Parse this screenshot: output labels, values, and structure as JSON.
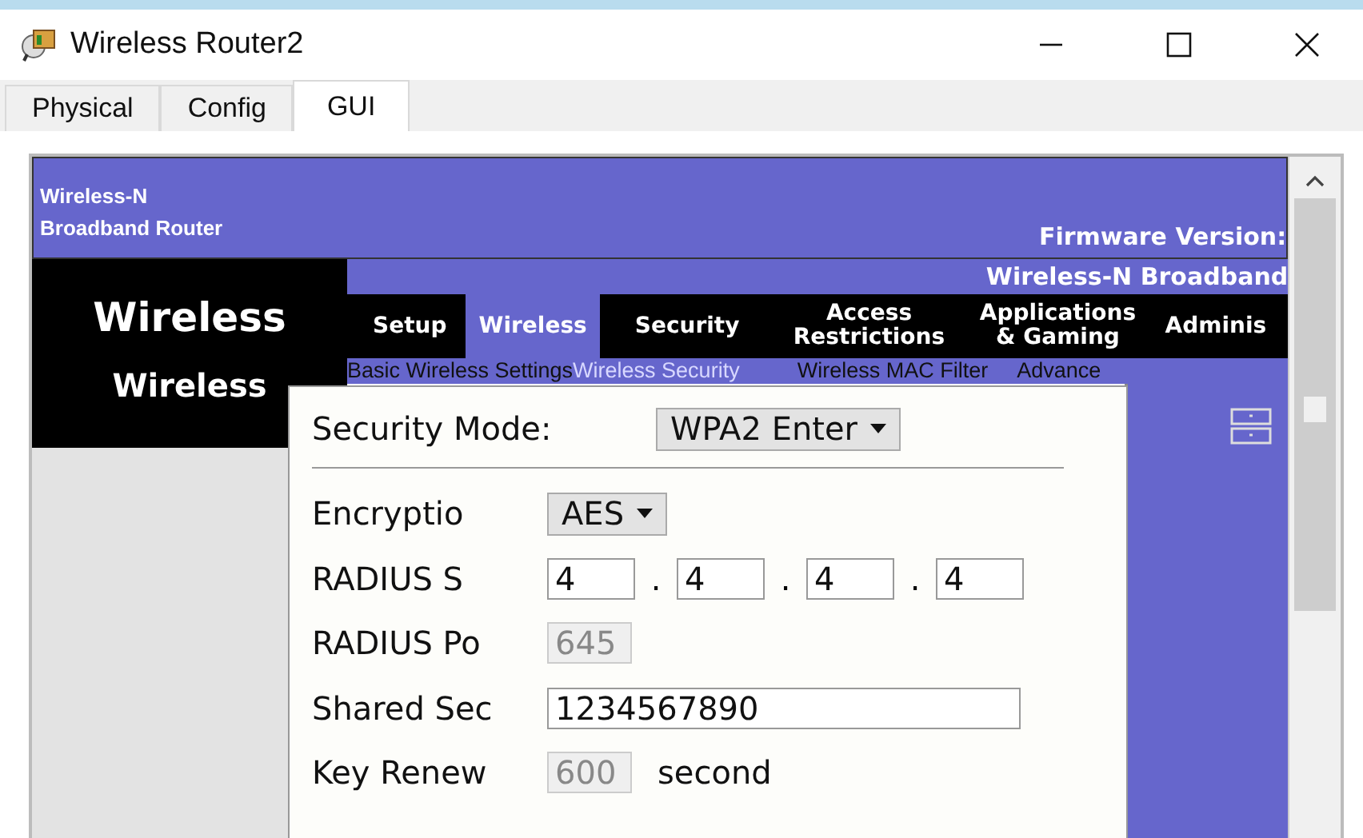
{
  "window": {
    "title": "Wireless Router2"
  },
  "tabs": [
    {
      "label": "Physical",
      "selected": false
    },
    {
      "label": "Config",
      "selected": false
    },
    {
      "label": "GUI",
      "selected": true
    }
  ],
  "router_page": {
    "header_lines": [
      "Wireless-N",
      "Broadband Router"
    ],
    "firmware_label": "Firmware Version:",
    "model_banner": "Wireless-N Broadband",
    "section_title": "Wireless",
    "subsection_title": "Wireless",
    "nav": [
      {
        "label": "Setup",
        "selected": false
      },
      {
        "label": "Wireless",
        "selected": true
      },
      {
        "label": "Security",
        "selected": false
      },
      {
        "label": "Access Restrictions",
        "selected": false
      },
      {
        "label": "Applications & Gaming",
        "selected": false
      },
      {
        "label": "Adminis",
        "selected": false
      }
    ],
    "subnav": [
      {
        "label": "Basic Wireless Settings",
        "selected": false
      },
      {
        "label": "Wireless Security",
        "selected": true
      },
      {
        "label": "Wireless MAC Filter",
        "selected": false
      },
      {
        "label": "Advance",
        "selected": false
      }
    ]
  },
  "security_panel": {
    "mode_label": "Security Mode:",
    "mode_value": "WPA2 Enter",
    "rows": [
      {
        "kind": "select",
        "label": "Encryptio",
        "value": "AES"
      },
      {
        "kind": "ip",
        "label": "RADIUS S",
        "octets": [
          "4",
          "4",
          "4",
          "4"
        ],
        "separator": "."
      },
      {
        "kind": "field",
        "label": "RADIUS Po",
        "value": "645",
        "disabled": true
      },
      {
        "kind": "field",
        "label": "Shared Sec",
        "value": "1234567890",
        "disabled": false
      },
      {
        "kind": "field",
        "label": "Key Renew",
        "value": "600",
        "disabled": true,
        "unit": "second"
      }
    ]
  }
}
